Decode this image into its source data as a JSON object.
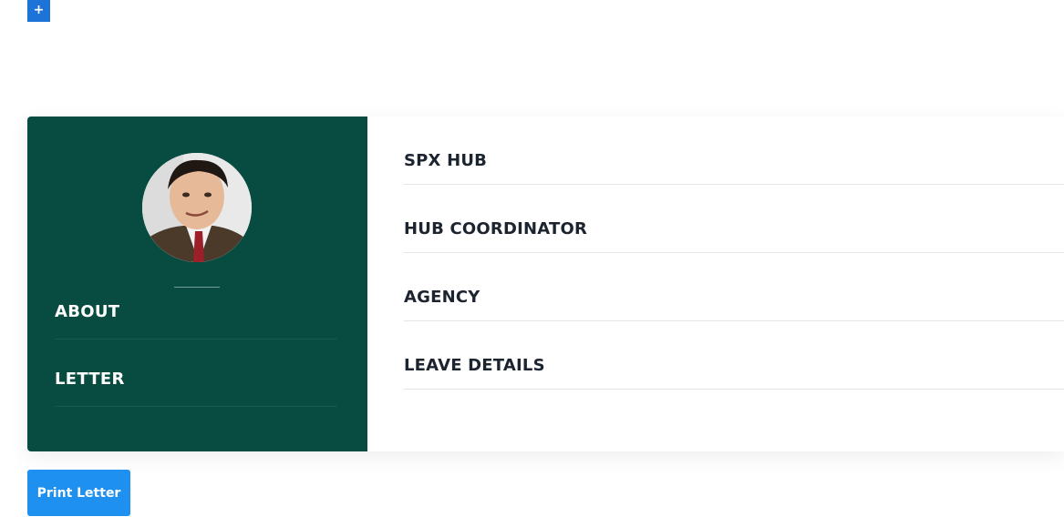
{
  "top": {
    "add_label": "+"
  },
  "profile": {
    "avatar": "person-photo"
  },
  "sidebar": {
    "items": [
      {
        "label": "ABOUT"
      },
      {
        "label": "LETTER"
      }
    ]
  },
  "details": {
    "fields": [
      {
        "label": "SPX HUB"
      },
      {
        "label": "HUB COORDINATOR"
      },
      {
        "label": "AGENCY"
      },
      {
        "label": "LEAVE DETAILS"
      }
    ]
  },
  "actions": {
    "print_label": "Print Letter"
  },
  "colors": {
    "sidebar_bg": "#084c41",
    "primary": "#1e90f0",
    "add_button": "#1e73d8",
    "heading_text": "#1c2430"
  }
}
